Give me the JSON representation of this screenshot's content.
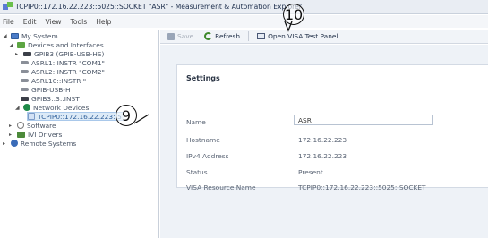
{
  "window": {
    "title": "TCPIP0::172.16.22.223::5025::SOCKET \"ASR\" - Measurement & Automation Explorer"
  },
  "menu": [
    "File",
    "Edit",
    "View",
    "Tools",
    "Help"
  ],
  "tree": {
    "items": [
      {
        "label": "My System",
        "icon": "monitor-icon",
        "toggle": "◢"
      },
      {
        "label": "Devices and Interfaces",
        "icon": "green-interface-icon",
        "toggle": "◢"
      },
      {
        "label": "GPIB3 (GPIB-USB-HS)",
        "icon": "device-icon",
        "toggle": "▸"
      },
      {
        "label": "ASRL1::INSTR \"COM1\"",
        "icon": "serial-port-icon",
        "toggle": ""
      },
      {
        "label": "ASRL2::INSTR \"COM2\"",
        "icon": "serial-port-icon",
        "toggle": ""
      },
      {
        "label": "ASRL10::INSTR \"",
        "icon": "serial-port-icon",
        "toggle": ""
      },
      {
        "label": "GPIB-USB-H",
        "icon": "usb-icon",
        "toggle": ""
      },
      {
        "label": "GPIB3::3::INST",
        "icon": "device-icon",
        "toggle": ""
      },
      {
        "label": "Network Devices",
        "icon": "network-icon",
        "toggle": "◢"
      },
      {
        "label": "TCPIP0::172.16.22.223::5",
        "icon": "socket-icon",
        "toggle": ""
      },
      {
        "label": "Software",
        "icon": "software-icon",
        "toggle": "▸"
      },
      {
        "label": "IVI Drivers",
        "icon": "driver-icon",
        "toggle": "▸"
      },
      {
        "label": "Remote Systems",
        "icon": "remote-systems-icon",
        "toggle": "▸"
      }
    ]
  },
  "toolbar": {
    "save_label": "Save",
    "refresh_label": "Refresh",
    "open_panel_label": "Open VISA Test Panel"
  },
  "settings": {
    "title": "Settings",
    "name_label": "Name",
    "name_value": "ASR",
    "hostname_label": "Hostname",
    "hostname_value": "172.16.22.223",
    "ipv4_label": "IPv4 Address",
    "ipv4_value": "172.16.22.223",
    "status_label": "Status",
    "status_value": "Present",
    "resource_label": "VISA Resource Name",
    "resource_value": "TCPIP0::172.16.22.223::5025::SOCKET"
  },
  "callouts": {
    "top": "10",
    "left": "9"
  }
}
